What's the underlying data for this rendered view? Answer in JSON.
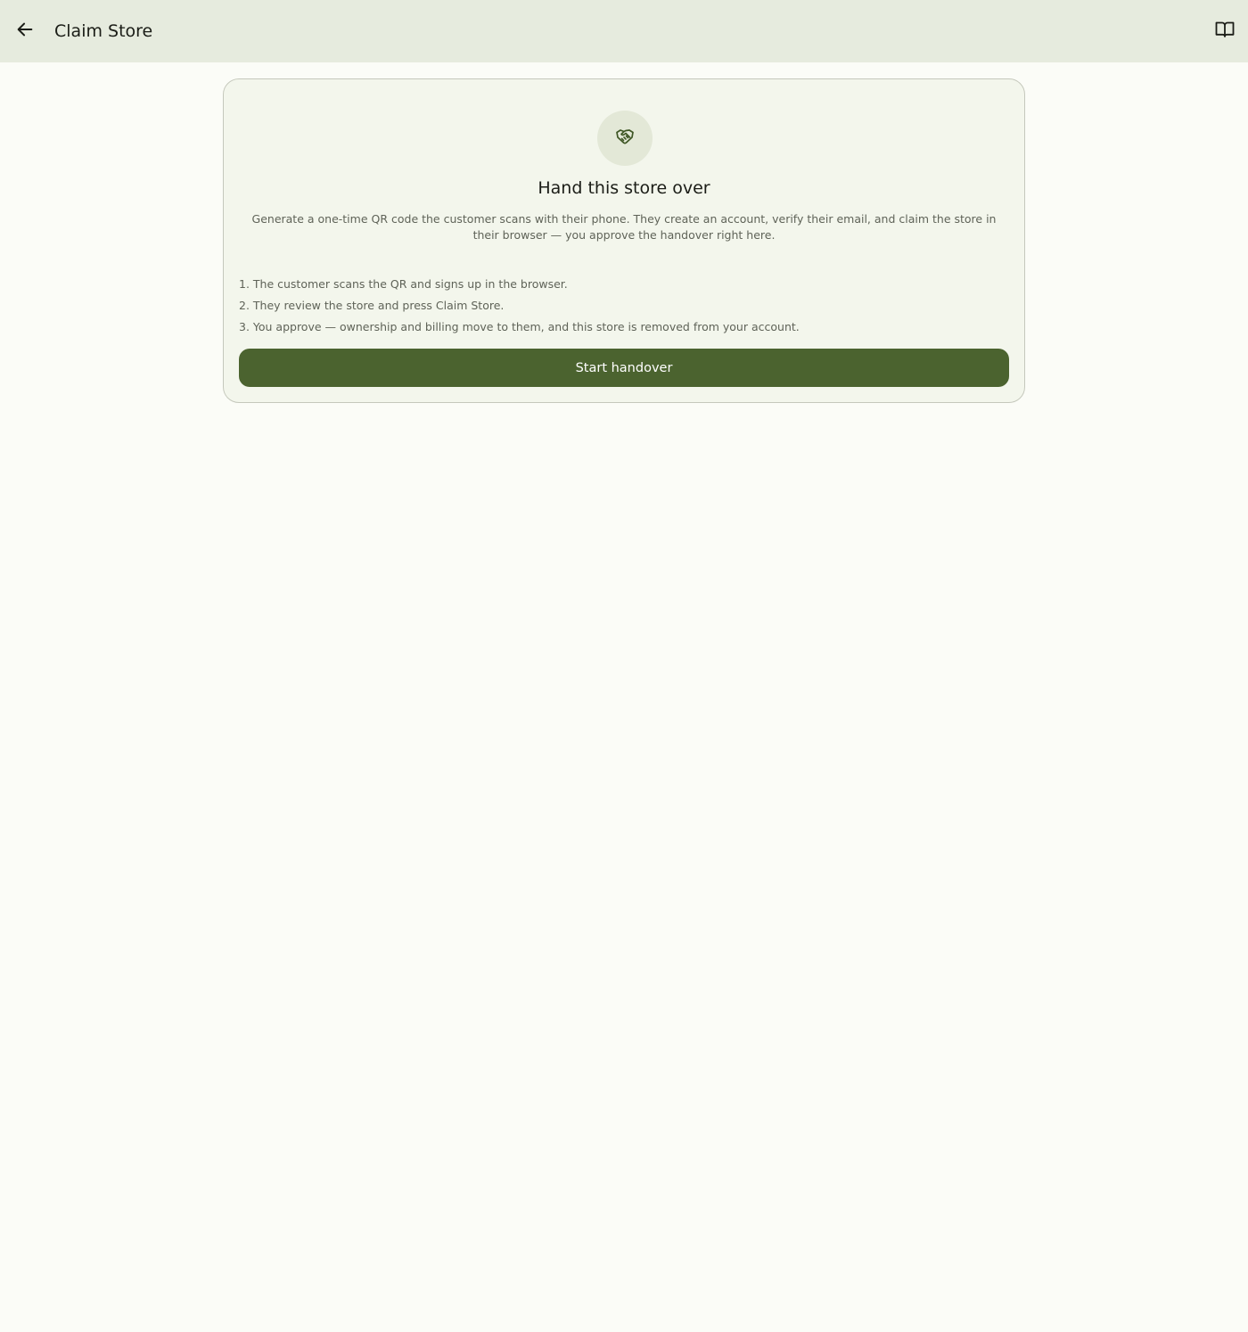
{
  "appbar": {
    "title": "Claim Store",
    "back_icon": "arrow-left-icon",
    "guide_icon": "book-open-icon"
  },
  "card": {
    "icon": "handshake-icon",
    "title": "Hand this store over",
    "description": "Generate a one-time QR code the customer scans with their phone. They create an account, verify their email, and claim the store in their browser — you approve the handover right here.",
    "steps": [
      "1. The customer scans the QR and signs up in the browser.",
      "2. They review the store and press Claim Store.",
      "3. You approve — ownership and billing move to them, and this store is removed from your account."
    ],
    "button_label": "Start handover"
  },
  "colors": {
    "appbar_bg": "#e6ebde",
    "page_bg": "#fbfcf7",
    "card_bg": "#f3f6ec",
    "accent": "#4b632f"
  }
}
